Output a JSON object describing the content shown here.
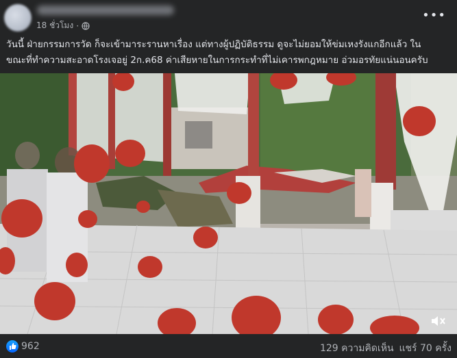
{
  "post": {
    "time": "18 ชั่วโมง",
    "more_icon": "more-horizontal-icon",
    "caption_line1": "วันนี้ ฝ่ายกรรมการวัด ก็จะเข้ามาระรานหาเรื่อง  แต่ทางผู้ปฏิบัติธรรม ดูจะไม่ยอมให้ข่มเหงรังแกอีกแล้ว   ใน",
    "caption_line2": "ขณะที่ทำความสะอาดโรงเจอยู่ 2ก.ค68 ค่าเสียหายในการกระทำที่ไม่เคารพกฎหมาย  อ่วมอรทัยแน่นอนครับ"
  },
  "reactions": {
    "like_count": "962",
    "comments": "129 ความคิดเห็น",
    "shares": "แชร์ 70 ครั้ง"
  },
  "colors": {
    "background": "#242526",
    "text": "#e4e6eb",
    "muted": "#b0b3b8",
    "like_blue": "#0766ff"
  }
}
